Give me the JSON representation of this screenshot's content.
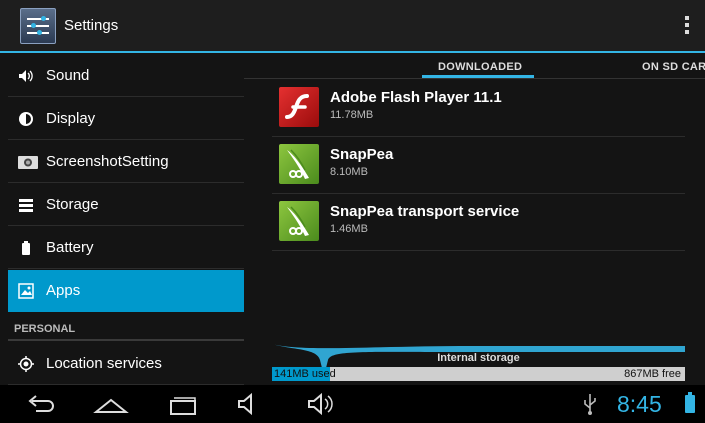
{
  "app": {
    "title": "Settings",
    "icon": "settings-sliders-icon",
    "overflow_icon": "overflow-menu-icon"
  },
  "sidebar": {
    "items": [
      {
        "label": "Sound",
        "icon": "speaker-icon"
      },
      {
        "label": "Display",
        "icon": "brightness-icon"
      },
      {
        "label": "ScreenshotSetting",
        "icon": "camera-icon"
      },
      {
        "label": "Storage",
        "icon": "storage-icon"
      },
      {
        "label": "Battery",
        "icon": "battery-icon"
      },
      {
        "label": "Apps",
        "icon": "apps-icon",
        "selected": true
      }
    ],
    "section_header": "PERSONAL",
    "personal_items": [
      {
        "label": "Location services",
        "icon": "location-icon"
      }
    ]
  },
  "tabs": [
    {
      "label": "DOWNLOADED",
      "selected": true
    },
    {
      "label": "ON SD CARD",
      "selected": false
    }
  ],
  "apps": [
    {
      "name": "Adobe Flash Player 11.1",
      "size": "11.78MB",
      "icon": "flash-player-icon"
    },
    {
      "name": "SnapPea",
      "size": "8.10MB",
      "icon": "snappea-icon"
    },
    {
      "name": "SnapPea transport service",
      "size": "1.46MB",
      "icon": "snappea-icon"
    }
  ],
  "storage": {
    "label": "Internal storage",
    "used": "141MB used",
    "free": "867MB free",
    "used_fraction": 0.14
  },
  "system_bar": {
    "nav": [
      "back-icon",
      "home-icon",
      "recent-apps-icon",
      "volume-down-icon",
      "volume-up-icon"
    ],
    "usb_icon": "usb-icon",
    "time": "8:45",
    "battery_icon": "battery-status-icon"
  },
  "colors": {
    "accent": "#33b5e5",
    "selected": "#0099cc",
    "background": "#141414",
    "flash_red": "#cc1b1b",
    "snappea_green": "#7ab833"
  }
}
